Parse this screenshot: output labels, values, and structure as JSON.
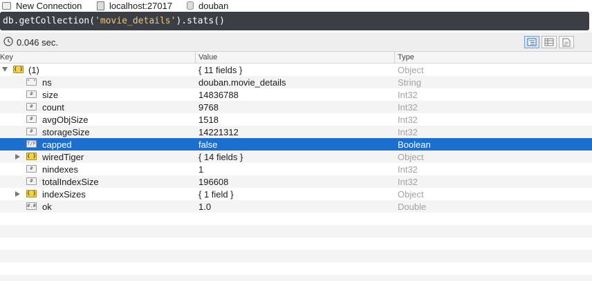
{
  "topbar": {
    "connection": "New Connection",
    "host": "localhost:27017",
    "database": "douban"
  },
  "query": {
    "prefix": "db.getCollection(",
    "collection": "'movie_details'",
    "suffix": ").stats()"
  },
  "status": {
    "elapsed": "0.046 sec."
  },
  "view_buttons": [
    "tree-view-icon",
    "table-view-icon",
    "text-view-icon"
  ],
  "columns": {
    "key": "Key",
    "value": "Value",
    "type": "Type"
  },
  "rows": [
    {
      "key": "(1)",
      "value": "{ 11 fields }",
      "type": "Object",
      "icon": "object-icon",
      "expander": "expanded"
    },
    {
      "key": "ns",
      "value": "douban.movie_details",
      "type": "String",
      "icon": "string-icon"
    },
    {
      "key": "size",
      "value": "14836788",
      "type": "Int32",
      "icon": "int-icon"
    },
    {
      "key": "count",
      "value": "9768",
      "type": "Int32",
      "icon": "int-icon"
    },
    {
      "key": "avgObjSize",
      "value": "1518",
      "type": "Int32",
      "icon": "int-icon"
    },
    {
      "key": "storageSize",
      "value": "14221312",
      "type": "Int32",
      "icon": "int-icon"
    },
    {
      "key": "capped",
      "value": "false",
      "type": "Boolean",
      "icon": "boolean-icon",
      "selected": true
    },
    {
      "key": "wiredTiger",
      "value": "{ 14 fields }",
      "type": "Object",
      "icon": "object-icon",
      "expander": "collapsed"
    },
    {
      "key": "nindexes",
      "value": "1",
      "type": "Int32",
      "icon": "int-icon"
    },
    {
      "key": "totalIndexSize",
      "value": "196608",
      "type": "Int32",
      "icon": "int-icon"
    },
    {
      "key": "indexSizes",
      "value": "{ 1 field }",
      "type": "Object",
      "icon": "object-icon",
      "expander": "collapsed"
    },
    {
      "key": "ok",
      "value": "1.0",
      "type": "Double",
      "icon": "double-icon"
    }
  ],
  "icon_glyphs": {
    "object-icon": "{ }",
    "string-icon": "\" \"",
    "int-icon": "#",
    "boolean-icon": "T/F",
    "double-icon": "#.#"
  },
  "colors": {
    "selection": "#1c6fd1",
    "editor_bg": "#3b3f45",
    "string_literal": "#f0c674"
  }
}
